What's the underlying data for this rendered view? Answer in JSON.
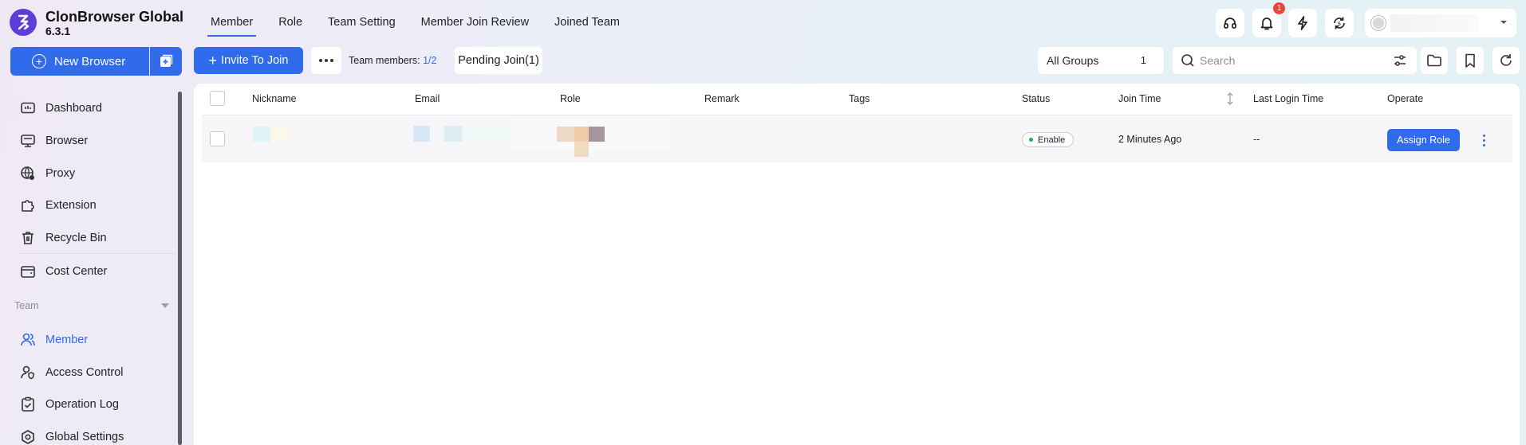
{
  "app": {
    "name": "ClonBrowser Global",
    "version": "6.3.1"
  },
  "tabs": [
    {
      "label": "Member",
      "active": true
    },
    {
      "label": "Role",
      "active": false
    },
    {
      "label": "Team Setting",
      "active": false
    },
    {
      "label": "Member Join Review",
      "active": false
    },
    {
      "label": "Joined Team",
      "active": false
    }
  ],
  "header": {
    "notification_count": "1"
  },
  "sidebar": {
    "new_browser_label": "New Browser",
    "items": [
      {
        "label": "Dashboard",
        "icon": "dashboard-icon"
      },
      {
        "label": "Browser",
        "icon": "browser-icon"
      },
      {
        "label": "Proxy",
        "icon": "proxy-icon"
      },
      {
        "label": "Extension",
        "icon": "extension-icon"
      },
      {
        "label": "Recycle Bin",
        "icon": "recycle-bin-icon"
      },
      {
        "label": "Cost Center",
        "icon": "cost-center-icon"
      }
    ],
    "team_section_label": "Team",
    "team_items": [
      {
        "label": "Member",
        "icon": "member-icon",
        "active": true
      },
      {
        "label": "Access Control",
        "icon": "access-control-icon"
      },
      {
        "label": "Operation Log",
        "icon": "operation-log-icon"
      },
      {
        "label": "Global Settings",
        "icon": "global-settings-icon"
      }
    ]
  },
  "toolbar": {
    "invite_label": "Invite To Join",
    "team_members_label": "Team members:",
    "team_members_value": "1/2",
    "pending_label": "Pending Join(1)",
    "group_filter": {
      "label": "All Groups",
      "count": "1"
    },
    "search_placeholder": "Search"
  },
  "table": {
    "columns": [
      "Nickname",
      "Email",
      "Role",
      "Remark",
      "Tags",
      "Status",
      "Join Time",
      "Last Login Time",
      "Operate"
    ],
    "rows": [
      {
        "status": "Enable",
        "join_time": "2 Minutes Ago",
        "last_login": "--",
        "action": "Assign Role"
      }
    ]
  },
  "colors": {
    "accent": "#2f6bea",
    "logo": "#5b3fd6",
    "badge": "#f2413c",
    "status_ok": "#27b24a"
  }
}
